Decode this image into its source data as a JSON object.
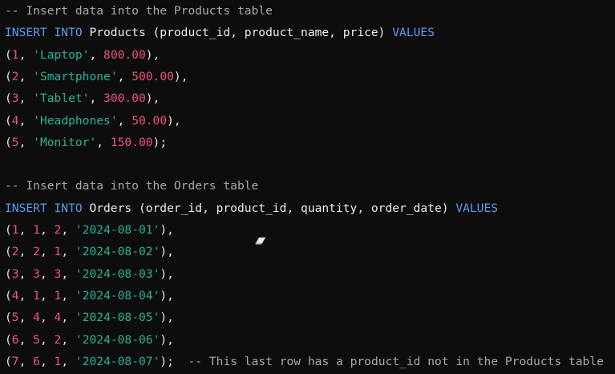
{
  "editor": {
    "lines": [
      [
        {
          "t": "comment",
          "v": "-- Insert data into the Products table"
        }
      ],
      [
        {
          "t": "keyword",
          "v": "INSERT INTO"
        },
        {
          "t": "ident",
          "v": " Products (product_id, product_name, price) "
        },
        {
          "t": "keyword",
          "v": "VALUES"
        }
      ],
      [
        {
          "t": "punct",
          "v": "("
        },
        {
          "t": "number",
          "v": "1"
        },
        {
          "t": "punct",
          "v": ", "
        },
        {
          "t": "string",
          "v": "'Laptop'"
        },
        {
          "t": "punct",
          "v": ", "
        },
        {
          "t": "number",
          "v": "800.00"
        },
        {
          "t": "punct",
          "v": "),"
        }
      ],
      [
        {
          "t": "punct",
          "v": "("
        },
        {
          "t": "number",
          "v": "2"
        },
        {
          "t": "punct",
          "v": ", "
        },
        {
          "t": "string",
          "v": "'Smartphone'"
        },
        {
          "t": "punct",
          "v": ", "
        },
        {
          "t": "number",
          "v": "500.00"
        },
        {
          "t": "punct",
          "v": "),"
        }
      ],
      [
        {
          "t": "punct",
          "v": "("
        },
        {
          "t": "number",
          "v": "3"
        },
        {
          "t": "punct",
          "v": ", "
        },
        {
          "t": "string",
          "v": "'Tablet'"
        },
        {
          "t": "punct",
          "v": ", "
        },
        {
          "t": "number",
          "v": "300.00"
        },
        {
          "t": "punct",
          "v": "),"
        }
      ],
      [
        {
          "t": "punct",
          "v": "("
        },
        {
          "t": "number",
          "v": "4"
        },
        {
          "t": "punct",
          "v": ", "
        },
        {
          "t": "string",
          "v": "'Headphones'"
        },
        {
          "t": "punct",
          "v": ", "
        },
        {
          "t": "number",
          "v": "50.00"
        },
        {
          "t": "punct",
          "v": "),"
        }
      ],
      [
        {
          "t": "punct",
          "v": "("
        },
        {
          "t": "number",
          "v": "5"
        },
        {
          "t": "punct",
          "v": ", "
        },
        {
          "t": "string",
          "v": "'Monitor'"
        },
        {
          "t": "punct",
          "v": ", "
        },
        {
          "t": "number",
          "v": "150.00"
        },
        {
          "t": "punct",
          "v": ");"
        }
      ],
      [],
      [
        {
          "t": "comment",
          "v": "-- Insert data into the Orders table"
        }
      ],
      [
        {
          "t": "keyword",
          "v": "INSERT INTO"
        },
        {
          "t": "ident",
          "v": " Orders (order_id, product_id, quantity, order_date) "
        },
        {
          "t": "keyword",
          "v": "VALUES"
        }
      ],
      [
        {
          "t": "punct",
          "v": "("
        },
        {
          "t": "number",
          "v": "1"
        },
        {
          "t": "punct",
          "v": ", "
        },
        {
          "t": "number",
          "v": "1"
        },
        {
          "t": "punct",
          "v": ", "
        },
        {
          "t": "number",
          "v": "2"
        },
        {
          "t": "punct",
          "v": ", "
        },
        {
          "t": "string",
          "v": "'2024-08-01'"
        },
        {
          "t": "punct",
          "v": "),"
        }
      ],
      [
        {
          "t": "punct",
          "v": "("
        },
        {
          "t": "number",
          "v": "2"
        },
        {
          "t": "punct",
          "v": ", "
        },
        {
          "t": "number",
          "v": "2"
        },
        {
          "t": "punct",
          "v": ", "
        },
        {
          "t": "number",
          "v": "1"
        },
        {
          "t": "punct",
          "v": ", "
        },
        {
          "t": "string",
          "v": "'2024-08-02'"
        },
        {
          "t": "punct",
          "v": "),"
        }
      ],
      [
        {
          "t": "punct",
          "v": "("
        },
        {
          "t": "number",
          "v": "3"
        },
        {
          "t": "punct",
          "v": ", "
        },
        {
          "t": "number",
          "v": "3"
        },
        {
          "t": "punct",
          "v": ", "
        },
        {
          "t": "number",
          "v": "3"
        },
        {
          "t": "punct",
          "v": ", "
        },
        {
          "t": "string",
          "v": "'2024-08-03'"
        },
        {
          "t": "punct",
          "v": "),"
        }
      ],
      [
        {
          "t": "punct",
          "v": "("
        },
        {
          "t": "number",
          "v": "4"
        },
        {
          "t": "punct",
          "v": ", "
        },
        {
          "t": "number",
          "v": "1"
        },
        {
          "t": "punct",
          "v": ", "
        },
        {
          "t": "number",
          "v": "1"
        },
        {
          "t": "punct",
          "v": ", "
        },
        {
          "t": "string",
          "v": "'2024-08-04'"
        },
        {
          "t": "punct",
          "v": "),"
        }
      ],
      [
        {
          "t": "punct",
          "v": "("
        },
        {
          "t": "number",
          "v": "5"
        },
        {
          "t": "punct",
          "v": ", "
        },
        {
          "t": "number",
          "v": "4"
        },
        {
          "t": "punct",
          "v": ", "
        },
        {
          "t": "number",
          "v": "4"
        },
        {
          "t": "punct",
          "v": ", "
        },
        {
          "t": "string",
          "v": "'2024-08-05'"
        },
        {
          "t": "punct",
          "v": "),"
        }
      ],
      [
        {
          "t": "punct",
          "v": "("
        },
        {
          "t": "number",
          "v": "6"
        },
        {
          "t": "punct",
          "v": ", "
        },
        {
          "t": "number",
          "v": "5"
        },
        {
          "t": "punct",
          "v": ", "
        },
        {
          "t": "number",
          "v": "2"
        },
        {
          "t": "punct",
          "v": ", "
        },
        {
          "t": "string",
          "v": "'2024-08-06'"
        },
        {
          "t": "punct",
          "v": "),"
        }
      ],
      [
        {
          "t": "punct",
          "v": "("
        },
        {
          "t": "number",
          "v": "7"
        },
        {
          "t": "punct",
          "v": ", "
        },
        {
          "t": "number",
          "v": "6"
        },
        {
          "t": "punct",
          "v": ", "
        },
        {
          "t": "number",
          "v": "1"
        },
        {
          "t": "punct",
          "v": ", "
        },
        {
          "t": "string",
          "v": "'2024-08-07'"
        },
        {
          "t": "punct",
          "v": ");  "
        },
        {
          "t": "comment",
          "v": "-- This last row has a product_id not in the Products table"
        }
      ]
    ]
  },
  "colors": {
    "background": "#0d0d0d",
    "comment": "#a8a8a8",
    "keyword": "#5b9bf0",
    "identifier": "#ececec",
    "number": "#f0557a",
    "string": "#27b39b"
  },
  "cursor": {
    "icon": "eraser-cursor-icon"
  }
}
